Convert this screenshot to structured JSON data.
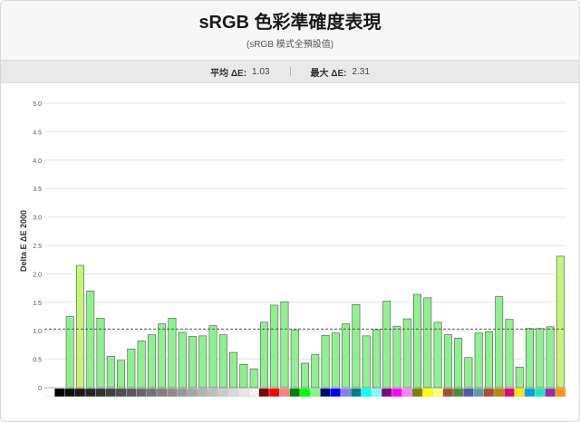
{
  "header": {
    "title": "sRGB 色彩準確度表現",
    "subtitle": "(sRGB 模式全預設值)"
  },
  "stats": {
    "avg_label": "平均 ΔE:",
    "avg_value": "1.03",
    "max_label": "最大 ΔE:",
    "max_value": "2.31"
  },
  "chart_data": {
    "type": "bar",
    "ylabel": "Delta E ΔE 2000",
    "ylim": [
      0,
      5
    ],
    "yticks": [
      "0",
      "0.5",
      "1.0",
      "1.5",
      "2.0",
      "2.5",
      "3.0",
      "3.5",
      "4.0",
      "4.5",
      "5.0"
    ],
    "grid": true,
    "reference_line": 1.03,
    "bar_color": "#8ef08e",
    "highlight_color": "#c6f57a",
    "categories": [
      "#ffffff",
      "#000000",
      "#0d0d0d",
      "#1a1a1a",
      "#262626",
      "#333333",
      "#404040",
      "#4d4d4d",
      "#595959",
      "#666666",
      "#737373",
      "#808080",
      "#8c8c8c",
      "#999999",
      "#a6a6a6",
      "#b3b3b3",
      "#bfbfbf",
      "#cccccc",
      "#d9d9d9",
      "#e6e6e6",
      "#f2f2f2",
      "#7f0000",
      "#ff0000",
      "#ff7f7f",
      "#007f00",
      "#00ff00",
      "#7fff7f",
      "#00007f",
      "#0000ff",
      "#7f7fff",
      "#007f7f",
      "#00ffff",
      "#7fffff",
      "#7f007f",
      "#ff00ff",
      "#ff7fff",
      "#7f7f00",
      "#ffff00",
      "#ffff7f",
      "#a0522d",
      "#4e8a3e",
      "#4b5ba8",
      "#5f9ea0",
      "#a0522d",
      "#b8860b",
      "#e3007f",
      "#ffe600",
      "#00a0e9",
      "#1de9b6",
      "#9c27b0",
      "#ff9800"
    ],
    "values": [
      0.0,
      1.25,
      2.15,
      1.7,
      1.22,
      0.55,
      0.48,
      0.68,
      0.82,
      0.93,
      1.12,
      1.22,
      0.97,
      0.9,
      0.91,
      1.09,
      0.93,
      0.62,
      0.41,
      0.33,
      1.15,
      1.45,
      1.51,
      1.01,
      0.43,
      0.58,
      0.92,
      0.96,
      1.12,
      1.46,
      0.91,
      1.02,
      1.52,
      1.08,
      1.21,
      1.64,
      1.58,
      1.15,
      0.93,
      0.87,
      0.53,
      0.96,
      0.98,
      1.6,
      1.2,
      0.36,
      1.04,
      1.04,
      1.07,
      2.31
    ]
  }
}
